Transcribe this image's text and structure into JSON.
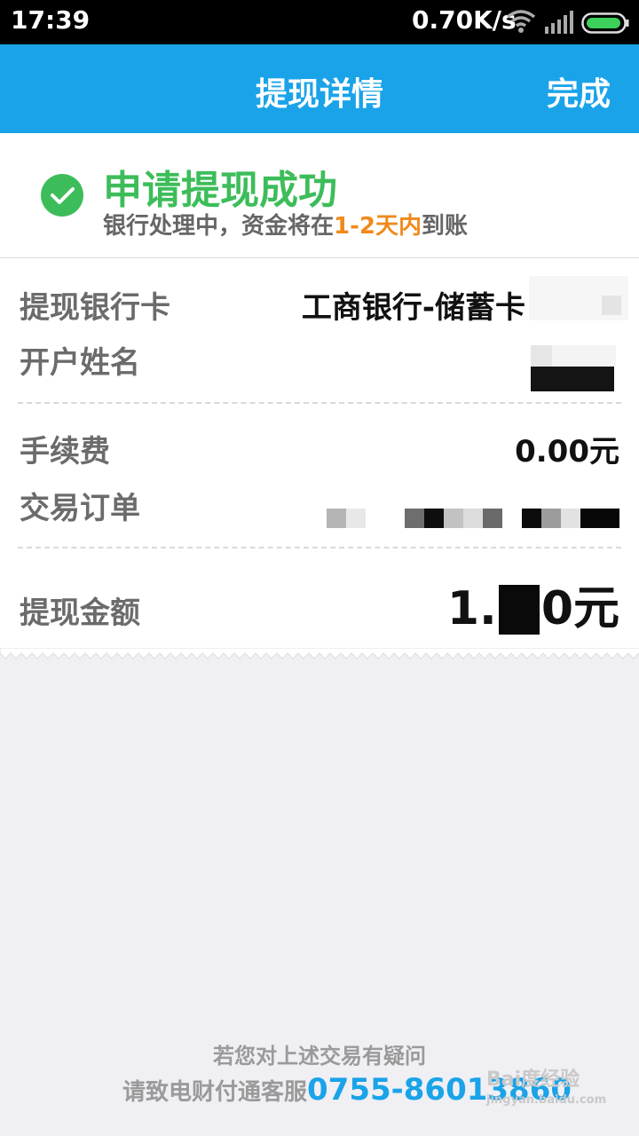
{
  "status_bar": {
    "time": "17:39",
    "network_speed": "0.70K/s"
  },
  "nav": {
    "title": "提现详情",
    "done_label": "完成"
  },
  "result": {
    "title": "申请提现成功",
    "subtitle_before": "银行处理中，资金将在",
    "subtitle_highlight": "1-2天内",
    "subtitle_after": "到账"
  },
  "details": {
    "bank_card_label": "提现银行卡",
    "bank_card_value": "工商银行-储蓄卡",
    "account_name_label": "开户姓名",
    "fee_label": "手续费",
    "fee_value": "0.00元",
    "order_label": "交易订单",
    "amount_label": "提现金额",
    "amount_prefix": "1.",
    "amount_suffix": "0元"
  },
  "footer": {
    "question": "若您对上述交易有疑问",
    "contact_prefix": "请致电财付通客服",
    "phone": "0755-86013860"
  },
  "watermark": {
    "brand": "Bai度经验",
    "url": "jingyan.baidu.com"
  },
  "colors": {
    "primary": "#1aa3e8",
    "success": "#3dbd5a",
    "highlight": "#f08a1c"
  },
  "icons": {
    "result": "check-circle-icon",
    "wifi": "wifi-icon",
    "signal": "signal-icon",
    "battery": "battery-icon"
  }
}
